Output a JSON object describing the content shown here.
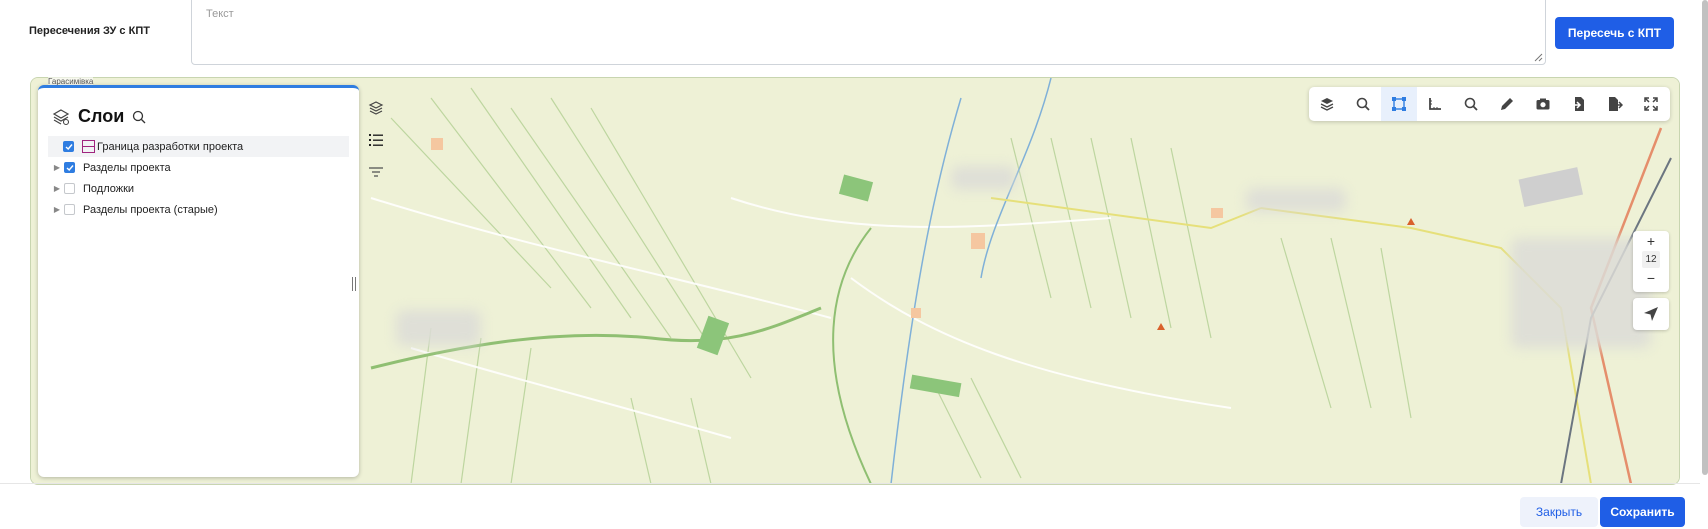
{
  "form": {
    "label": "Пересечения ЗУ с КПТ",
    "placeholder": "Текст",
    "intersect_button": "Пересечь с КПТ"
  },
  "map": {
    "place_label": "Гарасимівка",
    "zoom_level": "12",
    "toolbar": [
      {
        "name": "layers-icon"
      },
      {
        "name": "search-icon"
      },
      {
        "name": "select-area-icon"
      },
      {
        "name": "measure-icon"
      },
      {
        "name": "search-object-icon"
      },
      {
        "name": "pencil-icon"
      },
      {
        "name": "camera-icon"
      },
      {
        "name": "import-icon"
      },
      {
        "name": "export-icon"
      },
      {
        "name": "fullscreen-icon"
      }
    ]
  },
  "layers_panel": {
    "title": "Слои",
    "items": [
      {
        "label": "Граница разработки проекта",
        "checked": true,
        "expandable": false
      },
      {
        "label": "Разделы проекта",
        "checked": true,
        "expandable": true
      },
      {
        "label": "Подложки",
        "checked": false,
        "expandable": true
      },
      {
        "label": "Разделы проекта (старые)",
        "checked": false,
        "expandable": true
      }
    ]
  },
  "footer": {
    "close_button": "Закрыть",
    "save_button": "Сохранить"
  },
  "colors": {
    "primary": "#1f5ee6",
    "panel_accent": "#2f7de1",
    "map_bg": "#eef1d6",
    "legend_stroke": "#a0247e"
  }
}
